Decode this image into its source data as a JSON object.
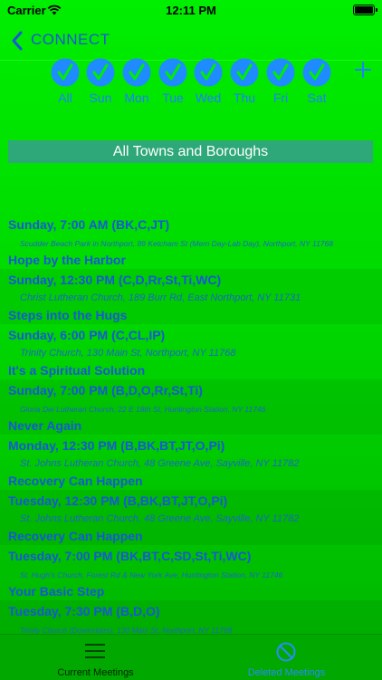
{
  "status": {
    "carrier": "Carrier",
    "time": "12:11 PM"
  },
  "nav": {
    "back_label": "CONNECT"
  },
  "days": [
    {
      "label": "All",
      "checked": true
    },
    {
      "label": "Sun",
      "checked": true
    },
    {
      "label": "Mon",
      "checked": true
    },
    {
      "label": "Tue",
      "checked": true
    },
    {
      "label": "Wed",
      "checked": true
    },
    {
      "label": "Thu",
      "checked": true
    },
    {
      "label": "Fri",
      "checked": true
    },
    {
      "label": "Sat",
      "checked": true
    }
  ],
  "town_filter": "All Towns and Boroughs",
  "meetings": [
    {
      "time": "Sunday, 7:00 AM (BK,C,JT)",
      "address": "Scudder Beach Park in Northport, 89 Ketcham St (Mem Day-Lab Day), Northport, NY 11768",
      "name": "Hope by the Harbor"
    },
    {
      "time": "Sunday, 12:30 PM (C,D,Rr,St,Ti,WC)",
      "address": "Christ Lutheran Church, 189 Burr Rd, East Northport, NY 11731",
      "name": "Steps into the Hugs"
    },
    {
      "time": "Sunday, 6:00 PM (C,CL,IP)",
      "address": "Trinity Church, 130 Main St, Northport, NY 11768",
      "name": "It's a Spiritual Solution"
    },
    {
      "time": "Sunday, 7:00 PM (B,D,O,Rr,St,Ti)",
      "address": "Gloria Dei Lutheran Church, 22 E 18th St, Huntington Station, NY 11746",
      "name": "Never Again"
    },
    {
      "time": "Monday, 12:30 PM (B,BK,BT,JT,O,Pi)",
      "address": "St. Johns Lutheran Church, 48 Greene Ave, Sayville, NY 11782",
      "name": "Recovery Can Happen"
    },
    {
      "time": "Tuesday, 12:30 PM (B,BK,BT,JT,O,Pi)",
      "address": "St. Johns Lutheran Church, 48 Greene Ave, Sayville, NY 11782",
      "name": "Recovery Can Happen"
    },
    {
      "time": "Tuesday, 7:00 PM (BK,BT,C,SD,St,Ti,WC)",
      "address": "St. Hugh's Church, Forest Rd & New York Ave, Huntington Station, NY 11746",
      "name": "Your Basic Step"
    },
    {
      "time": "Tuesday, 7:30 PM (B,D,O)",
      "address": "Trinity Church (Downstairs), 130 Main St, Northport, NY 11768",
      "name": ""
    }
  ],
  "tabs": [
    {
      "label": "Current Meetings",
      "icon": "list-icon"
    },
    {
      "label": "Deleted Meetings",
      "icon": "no-entry-icon"
    }
  ]
}
